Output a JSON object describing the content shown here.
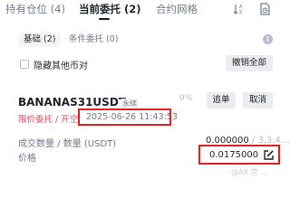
{
  "tabs": [
    {
      "label": "持有仓位 (4)"
    },
    {
      "label": "当前委托 (2)"
    },
    {
      "label": "合约网格"
    }
  ],
  "filters": {
    "basic_label": "基础 (2)",
    "conditional_label": "条件委托 (0)"
  },
  "hide_other_label": "隐藏其他币对",
  "cancel_all_label": "撤销全部",
  "order": {
    "symbol": "BANANAS31USDT",
    "type_badge": "永续",
    "percent": "0%",
    "chase_label": "追单",
    "cancel_label": "取消",
    "order_type": "限价委托 / 开空",
    "timestamp": "2025-06-26 11:43:53",
    "qty_label": "成交数量 / 数量 (USDT)",
    "qty_value": "0.000000",
    "qty_value_tail": "/ 3,3.4…",
    "price_label": "价格",
    "price_value": "0.0175000"
  },
  "watermark": "@AX 宫 …",
  "colors": {
    "accent_red": "#f6465d",
    "highlight_box": "#e02020",
    "text_primary": "#1e2329",
    "text_secondary": "#707a8a"
  }
}
